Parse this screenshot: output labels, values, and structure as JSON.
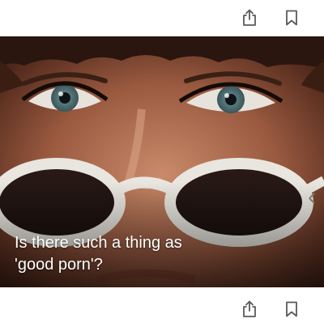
{
  "toolbar_top": {
    "share_icon": "share-icon",
    "bookmark_icon": "bookmark-icon"
  },
  "article": {
    "headline_line1": "Is there such a thing as",
    "headline_line2": "'good porn'?",
    "image": "close-up of a face with white oval sunglasses lowered on the nose"
  },
  "toolbar_bottom": {
    "share_icon": "share-icon",
    "bookmark_icon": "bookmark-icon"
  },
  "colors": {
    "icon": "#5a5a5a",
    "background": "#ffffff",
    "headline_text": "#ffffff"
  }
}
